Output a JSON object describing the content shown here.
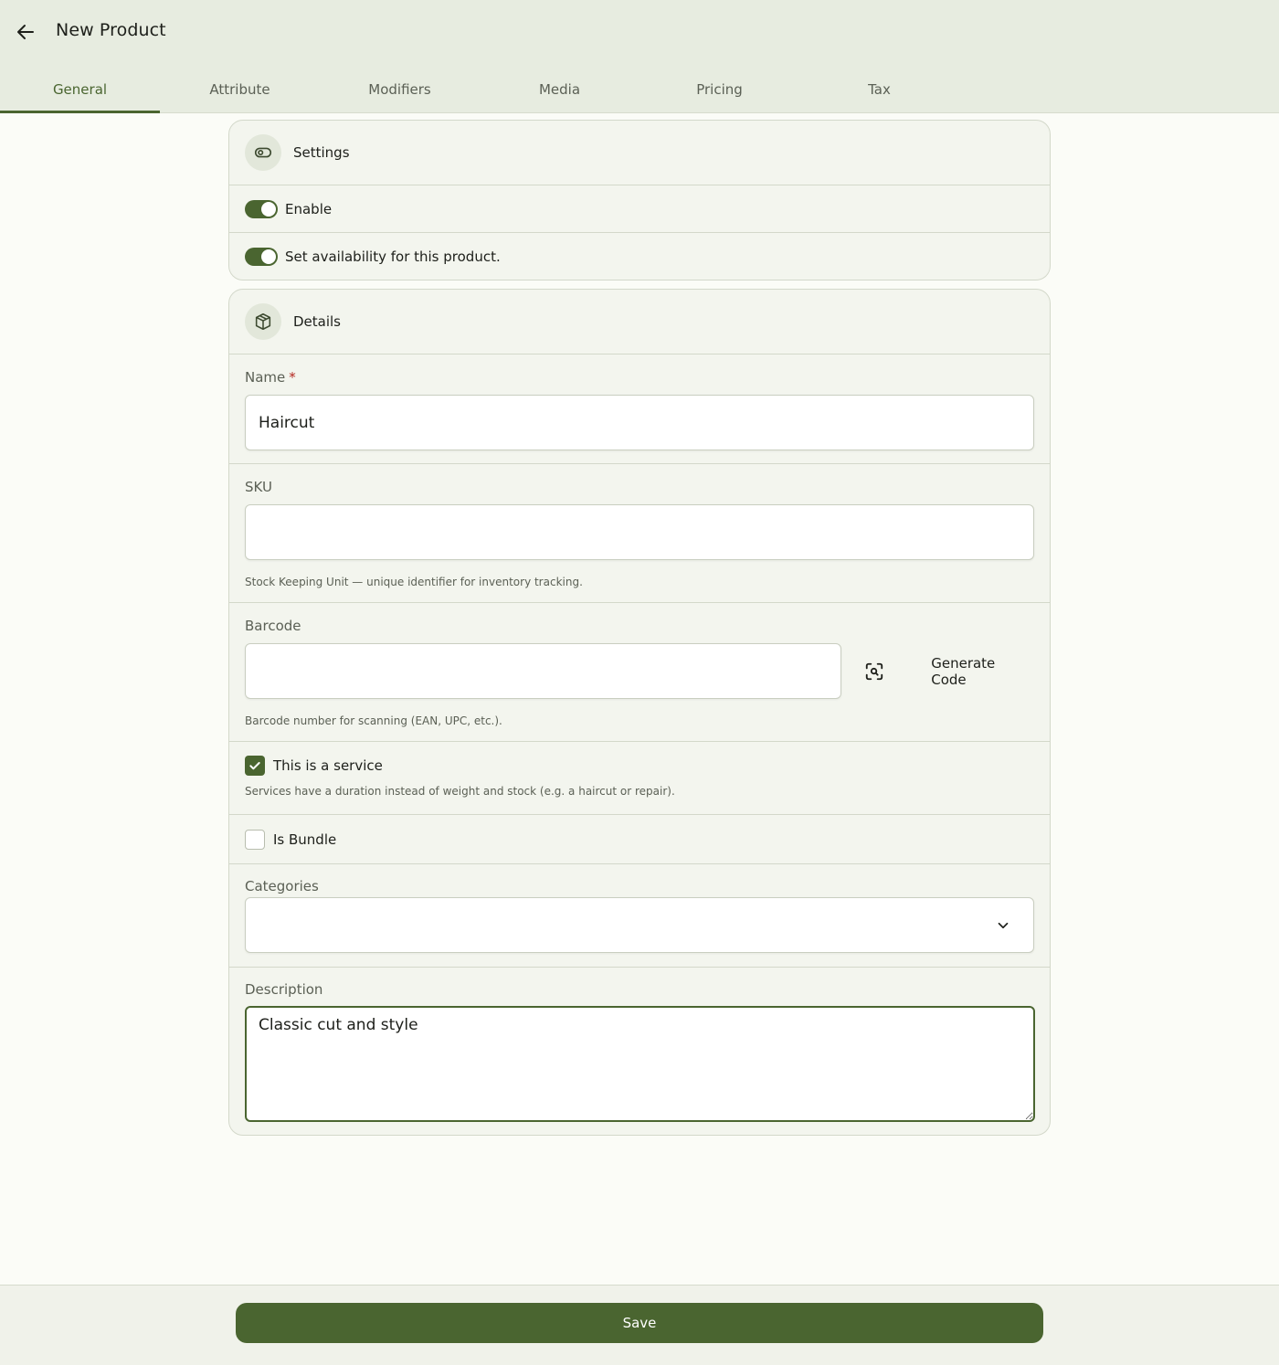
{
  "header": {
    "title": "New Product",
    "back_icon": "arrow-left-icon"
  },
  "tabs": [
    {
      "label": "General",
      "active": true
    },
    {
      "label": "Attribute",
      "active": false
    },
    {
      "label": "Modifiers",
      "active": false
    },
    {
      "label": "Media",
      "active": false
    },
    {
      "label": "Pricing",
      "active": false
    },
    {
      "label": "Tax",
      "active": false
    }
  ],
  "settings": {
    "title": "Settings",
    "icon": "toggle-icon",
    "enable_label": "Enable",
    "enable_on": true,
    "availability_label": "Set availability for this product.",
    "availability_on": true
  },
  "details": {
    "title": "Details",
    "icon": "package-icon",
    "name": {
      "label": "Name",
      "required_mark": "*",
      "value": "Haircut"
    },
    "sku": {
      "label": "SKU",
      "value": "",
      "helper": "Stock Keeping Unit — unique identifier for inventory tracking."
    },
    "barcode": {
      "label": "Barcode",
      "value": "",
      "scan_icon": "scan-icon",
      "generate_label": "Generate Code",
      "helper": "Barcode number for scanning (EAN, UPC, etc.)."
    },
    "service": {
      "label": "This is a service",
      "checked": true,
      "helper": "Services have a duration instead of weight and stock (e.g. a haircut or repair)."
    },
    "bundle": {
      "label": "Is Bundle",
      "checked": false
    },
    "categories": {
      "label": "Categories",
      "value": ""
    },
    "description": {
      "label": "Description",
      "value": "Classic cut and style"
    }
  },
  "footer": {
    "save_label": "Save"
  },
  "colors": {
    "accent": "#4a6530",
    "header_bg": "#e7ece0",
    "card_bg": "#f3f5ee",
    "required": "#b3261e"
  }
}
